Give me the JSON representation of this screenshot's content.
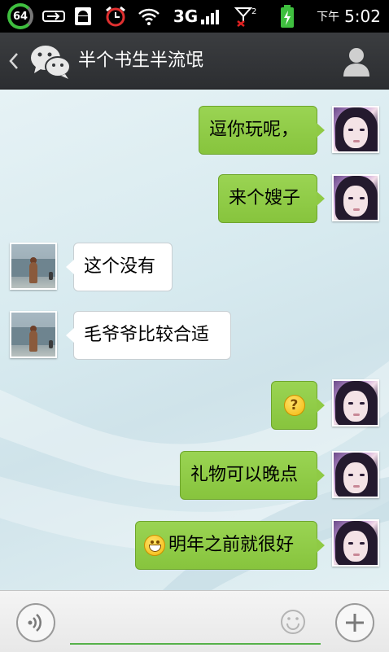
{
  "status_bar": {
    "battery_level": "64",
    "network": "3G",
    "signal_extra": "2",
    "time_period": "下午",
    "time": "5:02",
    "icons": [
      "battery-ring-icon",
      "usb-icon",
      "android-debug-icon",
      "alarm-icon",
      "wifi-icon",
      "signal-icon",
      "no-signal-icon",
      "charging-icon"
    ]
  },
  "header": {
    "title": "半个书生半流氓",
    "back_icon": "chevron-left-icon",
    "logo_icon": "wechat-icon",
    "profile_icon": "person-icon"
  },
  "messages": [
    {
      "from": "me",
      "text": "逗你玩呢，"
    },
    {
      "from": "me",
      "text": "来个嫂子"
    },
    {
      "from": "them",
      "text": "这个没有"
    },
    {
      "from": "them",
      "text": "毛爷爷比较合适"
    },
    {
      "from": "me",
      "text": "",
      "emoji": "confused-emoji-icon"
    },
    {
      "from": "me",
      "text": "礼物可以晚点"
    },
    {
      "from": "me",
      "text": "明年之前就很好",
      "emoji": "grin-emoji-icon"
    }
  ],
  "input_bar": {
    "value": "",
    "placeholder": "",
    "voice_icon": "voice-icon",
    "emoji_icon": "smiley-icon",
    "more_icon": "plus-icon"
  },
  "colors": {
    "bubble_me": "#8fca45",
    "bubble_them": "#ffffff",
    "header_bg": "#333538",
    "accent": "#56b24a"
  }
}
